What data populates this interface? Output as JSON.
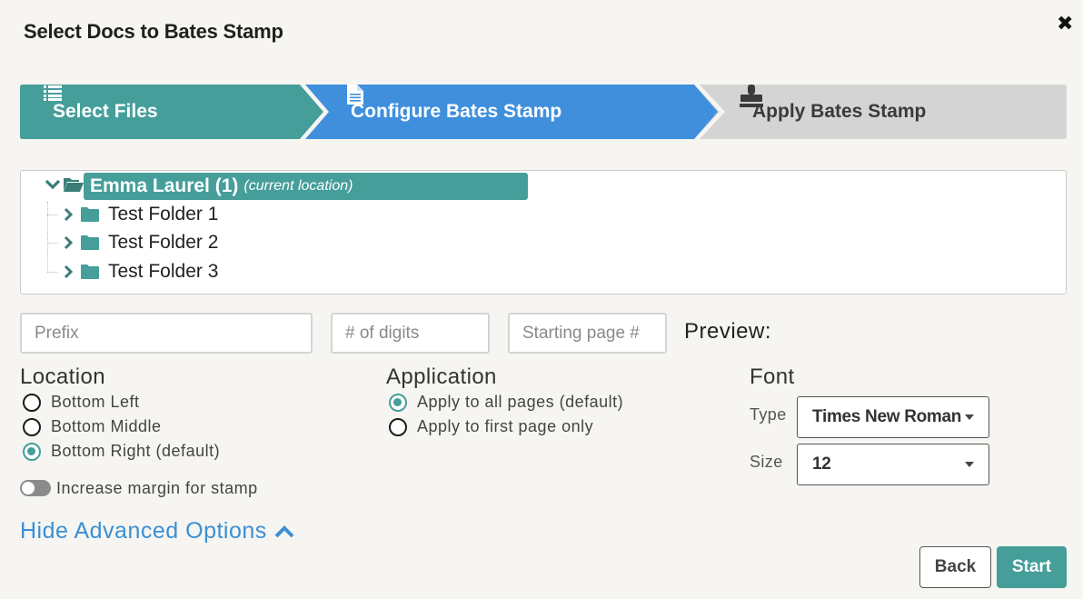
{
  "dialog": {
    "title": "Select Docs to Bates Stamp",
    "close_icon": "close-x-icon"
  },
  "stepper": {
    "steps": [
      {
        "label": "Select Files",
        "icon": "list-icon",
        "color": "#459e9a",
        "state": "completed"
      },
      {
        "label": "Configure Bates Stamp",
        "icon": "document-icon",
        "color": "#3f8fdd",
        "state": "active"
      },
      {
        "label": "Apply Bates Stamp",
        "icon": "stamp-icon",
        "color": "#d4d4d4",
        "state": "pending"
      }
    ]
  },
  "tree": {
    "root": {
      "name": "Emma Laurel (1)",
      "note": "(current location)",
      "expanded": true,
      "selected": true
    },
    "children": [
      {
        "name": "Test Folder 1"
      },
      {
        "name": "Test Folder 2"
      },
      {
        "name": "Test Folder 3"
      }
    ]
  },
  "fields": {
    "prefix": {
      "placeholder": "Prefix",
      "value": ""
    },
    "digits": {
      "placeholder": "# of digits",
      "value": ""
    },
    "start_page": {
      "placeholder": "Starting page #",
      "value": ""
    },
    "preview_label": "Preview:"
  },
  "location": {
    "heading": "Location",
    "options": [
      {
        "label": "Bottom Left",
        "selected": false
      },
      {
        "label": "Bottom Middle",
        "selected": false
      },
      {
        "label": "Bottom Right (default)",
        "selected": true
      }
    ],
    "margin_toggle": {
      "label": "Increase margin for stamp",
      "on": false
    }
  },
  "application": {
    "heading": "Application",
    "options": [
      {
        "label": "Apply to all pages (default)",
        "selected": true
      },
      {
        "label": "Apply to first page only",
        "selected": false
      }
    ]
  },
  "font": {
    "heading": "Font",
    "type_label": "Type",
    "type_value": "Times New Roman",
    "size_label": "Size",
    "size_value": "12"
  },
  "advanced": {
    "label": "Hide Advanced Options",
    "icon": "chevron-up-icon"
  },
  "buttons": {
    "back": "Back",
    "start": "Start"
  },
  "colors": {
    "accent_teal": "#459e9a",
    "accent_blue": "#3f8fdd",
    "link_blue": "#3b8fd4"
  }
}
